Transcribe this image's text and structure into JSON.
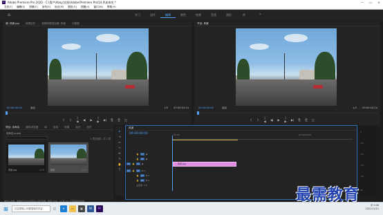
{
  "titlebar": {
    "app_icon": "Pr",
    "title": "Adobe Premiere Pro 2020 - C:\\用户\\Abay\\文档\\Adobe\\Premiere Pro\\14.0\\未命名 *",
    "min": "—",
    "max": "☐",
    "close": "✕"
  },
  "menu": [
    "文件(F)",
    "编辑(E)",
    "剪辑(C)",
    "序列(S)",
    "标记(M)",
    "图形(G)",
    "视图(V)",
    "窗口(W)",
    "帮助(H)"
  ],
  "workspaces": {
    "home_glyph": "⌂",
    "tabs": [
      "学习",
      "组件",
      "编辑",
      "颜色",
      "效果",
      "音频",
      "图形",
      "库"
    ],
    "active_index": 2,
    "more": "»"
  },
  "source_monitor": {
    "tabs": [
      "源: 风景.jpg",
      "效果控件",
      "音频剪辑混合器: 风景",
      "元数据"
    ],
    "timecode": "00:00:00:00",
    "fit": "适合",
    "ratio": "1/2",
    "duration": "00:00:04:24"
  },
  "program_monitor": {
    "tab": "节目: 风景",
    "timecode": "00:00:00:00",
    "fit": "适合",
    "ratio": "1/2",
    "duration": "00:00:04:24"
  },
  "transport_glyphs": [
    "{",
    "}",
    "|◀",
    "◀|",
    "▶",
    "|▶",
    "▶|",
    "⎘",
    "⎗",
    "◫"
  ],
  "project": {
    "tabs": [
      "项目: 未命名",
      "媒体浏览器",
      "库",
      "信息",
      "效果",
      "标记",
      "历史"
    ],
    "project_file": "未命名.prproj",
    "count": "1 项已选择，共 2 项",
    "items": [
      {
        "name": "风景.jpg",
        "duration": "4:29"
      },
      {
        "name": "风景",
        "duration": "4:29"
      }
    ]
  },
  "timeline": {
    "tab": "风景",
    "timecode": "00:00:00:00",
    "ruler_start": ":00:00",
    "ruler_mid": "00:00:05:00",
    "video_tracks": [
      "V3",
      "V2",
      "V1"
    ],
    "audio_tracks": [
      "A1",
      "A2",
      "A3"
    ],
    "master": "主声道",
    "master_value": "0.0",
    "clip_label": "风景.jpg"
  },
  "tools": [
    "▸",
    "⇥",
    "⇔",
    "✂",
    "⇹",
    "✎",
    "✋",
    "T"
  ],
  "meter_labels": [
    "0",
    "-12",
    "-24",
    "-36",
    "-48",
    "dB"
  ],
  "taskbar": {
    "search": "在这里输入你要搜索的内容",
    "clock": "9:06",
    "date": "2021/11/12",
    "lang": "中"
  },
  "status_hint": "单击以选择，或单击空白处并拖动以进行选择。使用 Shift、Alt 和 Ctrl 可获得其他选项。",
  "watermark": "最需教育",
  "colors": {
    "accent": "#4fa3ff",
    "clip": "#e08de4",
    "panel": "#232323"
  }
}
